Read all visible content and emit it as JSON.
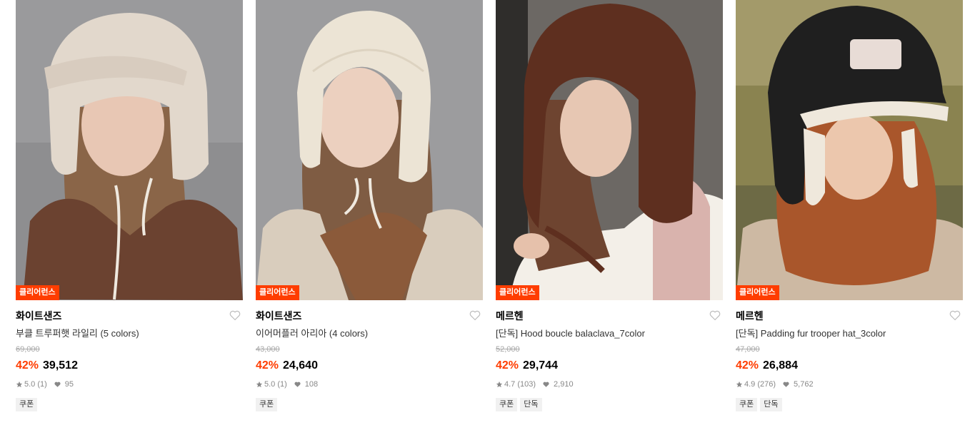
{
  "colors": {
    "sale_red": "#ff3d00",
    "heart_gray": "#bdbdbd"
  },
  "products": [
    {
      "tag": "클리어런스",
      "brand": "화이트샌즈",
      "name": "부클 트루퍼햇 라일리 (5 colors)",
      "original_price": "69,000",
      "discount": "42%",
      "price": "39,512",
      "rating": "5.0 (1)",
      "likes": "95",
      "badges": [
        "쿠폰"
      ]
    },
    {
      "tag": "클리어런스",
      "brand": "화이트샌즈",
      "name": "이어머플러 아리아 (4 colors)",
      "original_price": "43,000",
      "discount": "42%",
      "price": "24,640",
      "rating": "5.0 (1)",
      "likes": "108",
      "badges": [
        "쿠폰"
      ]
    },
    {
      "tag": "클리어런스",
      "brand": "메르헨",
      "name": "[단독] Hood boucle balaclava_7color",
      "original_price": "52,000",
      "discount": "42%",
      "price": "29,744",
      "rating": "4.7 (103)",
      "likes": "2,910",
      "badges": [
        "쿠폰",
        "단독"
      ]
    },
    {
      "tag": "클리어런스",
      "brand": "메르헨",
      "name": "[단독] Padding fur trooper hat_3color",
      "original_price": "47,000",
      "discount": "42%",
      "price": "26,884",
      "rating": "4.9 (276)",
      "likes": "5,762",
      "badges": [
        "쿠폰",
        "단독"
      ]
    }
  ]
}
